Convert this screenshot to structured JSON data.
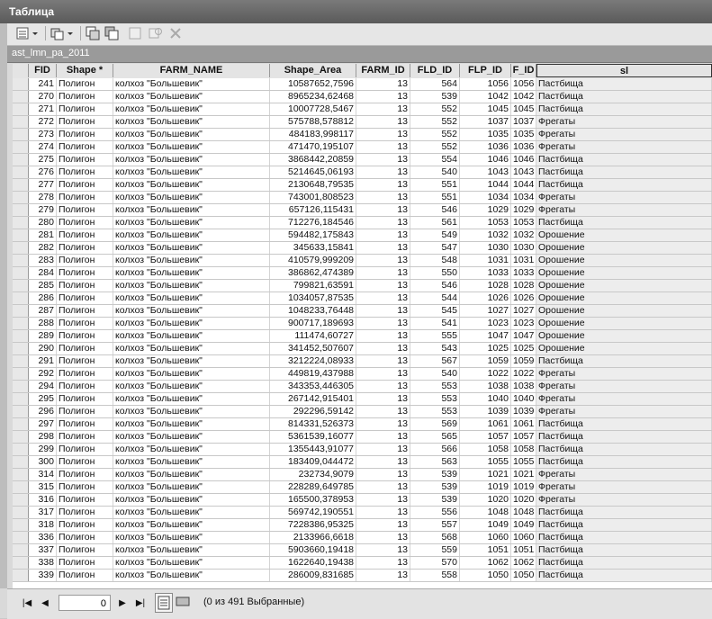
{
  "window": {
    "title": "Таблица"
  },
  "table_name": "ast_lmn_pa_2011",
  "columns": [
    {
      "key": "fid",
      "label": "FID"
    },
    {
      "key": "shape",
      "label": "Shape *"
    },
    {
      "key": "farm",
      "label": "FARM_NAME"
    },
    {
      "key": "area",
      "label": "Shape_Area"
    },
    {
      "key": "farm_id",
      "label": "FARM_ID"
    },
    {
      "key": "fld",
      "label": "FLD_ID"
    },
    {
      "key": "flp",
      "label": "FLP_ID"
    },
    {
      "key": "f_id",
      "label": "F_ID"
    },
    {
      "key": "sl",
      "label": "sl"
    }
  ],
  "rows": [
    [
      "241",
      "Полигон",
      "колхоз \"Большевик\"",
      "10587652,7596",
      "13",
      "564",
      "1056",
      "1056",
      "Пастбища"
    ],
    [
      "270",
      "Полигон",
      "колхоз \"Большевик\"",
      "8965234,62468",
      "13",
      "539",
      "1042",
      "1042",
      "Пастбища"
    ],
    [
      "271",
      "Полигон",
      "колхоз \"Большевик\"",
      "10007728,5467",
      "13",
      "552",
      "1045",
      "1045",
      "Пастбища"
    ],
    [
      "272",
      "Полигон",
      "колхоз \"Большевик\"",
      "575788,578812",
      "13",
      "552",
      "1037",
      "1037",
      "Фрегаты"
    ],
    [
      "273",
      "Полигон",
      "колхоз \"Большевик\"",
      "484183,998117",
      "13",
      "552",
      "1035",
      "1035",
      "Фрегаты"
    ],
    [
      "274",
      "Полигон",
      "колхоз \"Большевик\"",
      "471470,195107",
      "13",
      "552",
      "1036",
      "1036",
      "Фрегаты"
    ],
    [
      "275",
      "Полигон",
      "колхоз \"Большевик\"",
      "3868442,20859",
      "13",
      "554",
      "1046",
      "1046",
      "Пастбища"
    ],
    [
      "276",
      "Полигон",
      "колхоз \"Большевик\"",
      "5214645,06193",
      "13",
      "540",
      "1043",
      "1043",
      "Пастбища"
    ],
    [
      "277",
      "Полигон",
      "колхоз \"Большевик\"",
      "2130648,79535",
      "13",
      "551",
      "1044",
      "1044",
      "Пастбища"
    ],
    [
      "278",
      "Полигон",
      "колхоз \"Большевик\"",
      "743001,808523",
      "13",
      "551",
      "1034",
      "1034",
      "Фрегаты"
    ],
    [
      "279",
      "Полигон",
      "колхоз \"Большевик\"",
      "657126,115431",
      "13",
      "546",
      "1029",
      "1029",
      "Фрегаты"
    ],
    [
      "280",
      "Полигон",
      "колхоз \"Большевик\"",
      "712276,184546",
      "13",
      "561",
      "1053",
      "1053",
      "Пастбища"
    ],
    [
      "281",
      "Полигон",
      "колхоз \"Большевик\"",
      "594482,175843",
      "13",
      "549",
      "1032",
      "1032",
      "Орошение"
    ],
    [
      "282",
      "Полигон",
      "колхоз \"Большевик\"",
      "345633,15841",
      "13",
      "547",
      "1030",
      "1030",
      "Орошение"
    ],
    [
      "283",
      "Полигон",
      "колхоз \"Большевик\"",
      "410579,999209",
      "13",
      "548",
      "1031",
      "1031",
      "Орошение"
    ],
    [
      "284",
      "Полигон",
      "колхоз \"Большевик\"",
      "386862,474389",
      "13",
      "550",
      "1033",
      "1033",
      "Орошение"
    ],
    [
      "285",
      "Полигон",
      "колхоз \"Большевик\"",
      "799821,63591",
      "13",
      "546",
      "1028",
      "1028",
      "Орошение"
    ],
    [
      "286",
      "Полигон",
      "колхоз \"Большевик\"",
      "1034057,87535",
      "13",
      "544",
      "1026",
      "1026",
      "Орошение"
    ],
    [
      "287",
      "Полигон",
      "колхоз \"Большевик\"",
      "1048233,76448",
      "13",
      "545",
      "1027",
      "1027",
      "Орошение"
    ],
    [
      "288",
      "Полигон",
      "колхоз \"Большевик\"",
      "900717,189693",
      "13",
      "541",
      "1023",
      "1023",
      "Орошение"
    ],
    [
      "289",
      "Полигон",
      "колхоз \"Большевик\"",
      "111474,60727",
      "13",
      "555",
      "1047",
      "1047",
      "Орошение"
    ],
    [
      "290",
      "Полигон",
      "колхоз \"Большевик\"",
      "341452,507607",
      "13",
      "543",
      "1025",
      "1025",
      "Орошение"
    ],
    [
      "291",
      "Полигон",
      "колхоз \"Большевик\"",
      "3212224,08933",
      "13",
      "567",
      "1059",
      "1059",
      "Пастбища"
    ],
    [
      "292",
      "Полигон",
      "колхоз \"Большевик\"",
      "449819,437988",
      "13",
      "540",
      "1022",
      "1022",
      "Фрегаты"
    ],
    [
      "294",
      "Полигон",
      "колхоз \"Большевик\"",
      "343353,446305",
      "13",
      "553",
      "1038",
      "1038",
      "Фрегаты"
    ],
    [
      "295",
      "Полигон",
      "колхоз \"Большевик\"",
      "267142,915401",
      "13",
      "553",
      "1040",
      "1040",
      "Фрегаты"
    ],
    [
      "296",
      "Полигон",
      "колхоз \"Большевик\"",
      "292296,59142",
      "13",
      "553",
      "1039",
      "1039",
      "Фрегаты"
    ],
    [
      "297",
      "Полигон",
      "колхоз \"Большевик\"",
      "814331,526373",
      "13",
      "569",
      "1061",
      "1061",
      "Пастбища"
    ],
    [
      "298",
      "Полигон",
      "колхоз \"Большевик\"",
      "5361539,16077",
      "13",
      "565",
      "1057",
      "1057",
      "Пастбища"
    ],
    [
      "299",
      "Полигон",
      "колхоз \"Большевик\"",
      "1355443,91077",
      "13",
      "566",
      "1058",
      "1058",
      "Пастбища"
    ],
    [
      "300",
      "Полигон",
      "колхоз \"Большевик\"",
      "183409,044472",
      "13",
      "563",
      "1055",
      "1055",
      "Пастбища"
    ],
    [
      "314",
      "Полигон",
      "колхоз \"Большевик\"",
      "232734,9079",
      "13",
      "539",
      "1021",
      "1021",
      "Фрегаты"
    ],
    [
      "315",
      "Полигон",
      "колхоз \"Большевик\"",
      "228289,649785",
      "13",
      "539",
      "1019",
      "1019",
      "Фрегаты"
    ],
    [
      "316",
      "Полигон",
      "колхоз \"Большевик\"",
      "165500,378953",
      "13",
      "539",
      "1020",
      "1020",
      "Фрегаты"
    ],
    [
      "317",
      "Полигон",
      "колхоз \"Большевик\"",
      "569742,190551",
      "13",
      "556",
      "1048",
      "1048",
      "Пастбища"
    ],
    [
      "318",
      "Полигон",
      "колхоз \"Большевик\"",
      "7228386,95325",
      "13",
      "557",
      "1049",
      "1049",
      "Пастбища"
    ],
    [
      "336",
      "Полигон",
      "колхоз \"Большевик\"",
      "2133966,6618",
      "13",
      "568",
      "1060",
      "1060",
      "Пастбища"
    ],
    [
      "337",
      "Полигон",
      "колхоз \"Большевик\"",
      "5903660,19418",
      "13",
      "559",
      "1051",
      "1051",
      "Пастбища"
    ],
    [
      "338",
      "Полигон",
      "колхоз \"Большевик\"",
      "1622640,19438",
      "13",
      "570",
      "1062",
      "1062",
      "Пастбища"
    ],
    [
      "339",
      "Полигон",
      "колхоз \"Большевик\"",
      "286009,831685",
      "13",
      "558",
      "1050",
      "1050",
      "Пастбища"
    ]
  ],
  "status": {
    "record_input": "0",
    "summary": "(0 из 491 Выбранные)"
  },
  "icons": {
    "table_options": "table-options-icon",
    "related_tables": "related-tables-icon",
    "select_by_attributes": "select-by-attributes-icon",
    "switch_selection": "switch-selection-icon",
    "clear_selection": "clear-selection-icon",
    "zoom_to_selected": "zoom-to-selected-icon",
    "delete_selected": "delete-selected-icon"
  }
}
